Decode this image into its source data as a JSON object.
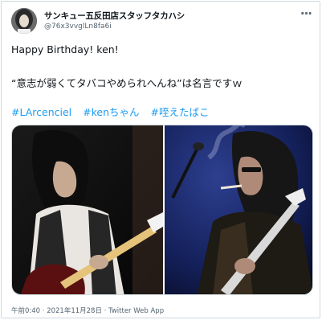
{
  "tweet": {
    "display_name": "サンキュー五反田店スタッフタカハシ",
    "handle": "@76x3vvglLn8fa6i",
    "more_icon": "more-horizontal-icon",
    "line1": "Happy Birthday! ken!",
    "line2": "“意志が弱くてタバコやめられへんね”は名言ですｗ",
    "hashtags": [
      "#LArcenciel",
      "#kenちゃん",
      "#咥えたばこ"
    ],
    "meta": "午前0:40 · 2021年11月28日 · Twitter Web App"
  },
  "colors": {
    "link": "#1d9bf0",
    "text": "#0f1419",
    "secondary": "#536471",
    "border": "#cfd9de"
  }
}
